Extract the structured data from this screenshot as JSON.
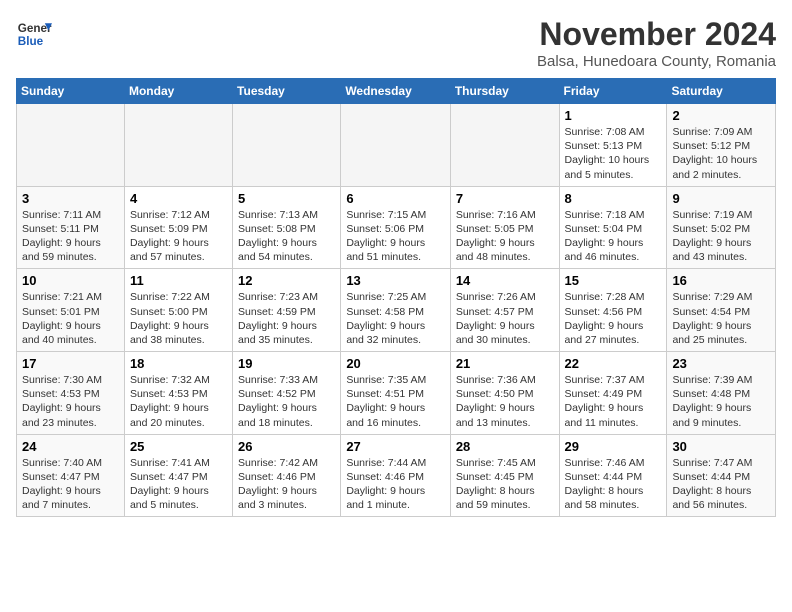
{
  "logo": {
    "line1": "General",
    "line2": "Blue"
  },
  "title": "November 2024",
  "subtitle": "Balsa, Hunedoara County, Romania",
  "headers": [
    "Sunday",
    "Monday",
    "Tuesday",
    "Wednesday",
    "Thursday",
    "Friday",
    "Saturday"
  ],
  "weeks": [
    [
      {
        "day": "",
        "info": ""
      },
      {
        "day": "",
        "info": ""
      },
      {
        "day": "",
        "info": ""
      },
      {
        "day": "",
        "info": ""
      },
      {
        "day": "",
        "info": ""
      },
      {
        "day": "1",
        "info": "Sunrise: 7:08 AM\nSunset: 5:13 PM\nDaylight: 10 hours\nand 5 minutes."
      },
      {
        "day": "2",
        "info": "Sunrise: 7:09 AM\nSunset: 5:12 PM\nDaylight: 10 hours\nand 2 minutes."
      }
    ],
    [
      {
        "day": "3",
        "info": "Sunrise: 7:11 AM\nSunset: 5:11 PM\nDaylight: 9 hours\nand 59 minutes."
      },
      {
        "day": "4",
        "info": "Sunrise: 7:12 AM\nSunset: 5:09 PM\nDaylight: 9 hours\nand 57 minutes."
      },
      {
        "day": "5",
        "info": "Sunrise: 7:13 AM\nSunset: 5:08 PM\nDaylight: 9 hours\nand 54 minutes."
      },
      {
        "day": "6",
        "info": "Sunrise: 7:15 AM\nSunset: 5:06 PM\nDaylight: 9 hours\nand 51 minutes."
      },
      {
        "day": "7",
        "info": "Sunrise: 7:16 AM\nSunset: 5:05 PM\nDaylight: 9 hours\nand 48 minutes."
      },
      {
        "day": "8",
        "info": "Sunrise: 7:18 AM\nSunset: 5:04 PM\nDaylight: 9 hours\nand 46 minutes."
      },
      {
        "day": "9",
        "info": "Sunrise: 7:19 AM\nSunset: 5:02 PM\nDaylight: 9 hours\nand 43 minutes."
      }
    ],
    [
      {
        "day": "10",
        "info": "Sunrise: 7:21 AM\nSunset: 5:01 PM\nDaylight: 9 hours\nand 40 minutes."
      },
      {
        "day": "11",
        "info": "Sunrise: 7:22 AM\nSunset: 5:00 PM\nDaylight: 9 hours\nand 38 minutes."
      },
      {
        "day": "12",
        "info": "Sunrise: 7:23 AM\nSunset: 4:59 PM\nDaylight: 9 hours\nand 35 minutes."
      },
      {
        "day": "13",
        "info": "Sunrise: 7:25 AM\nSunset: 4:58 PM\nDaylight: 9 hours\nand 32 minutes."
      },
      {
        "day": "14",
        "info": "Sunrise: 7:26 AM\nSunset: 4:57 PM\nDaylight: 9 hours\nand 30 minutes."
      },
      {
        "day": "15",
        "info": "Sunrise: 7:28 AM\nSunset: 4:56 PM\nDaylight: 9 hours\nand 27 minutes."
      },
      {
        "day": "16",
        "info": "Sunrise: 7:29 AM\nSunset: 4:54 PM\nDaylight: 9 hours\nand 25 minutes."
      }
    ],
    [
      {
        "day": "17",
        "info": "Sunrise: 7:30 AM\nSunset: 4:53 PM\nDaylight: 9 hours\nand 23 minutes."
      },
      {
        "day": "18",
        "info": "Sunrise: 7:32 AM\nSunset: 4:53 PM\nDaylight: 9 hours\nand 20 minutes."
      },
      {
        "day": "19",
        "info": "Sunrise: 7:33 AM\nSunset: 4:52 PM\nDaylight: 9 hours\nand 18 minutes."
      },
      {
        "day": "20",
        "info": "Sunrise: 7:35 AM\nSunset: 4:51 PM\nDaylight: 9 hours\nand 16 minutes."
      },
      {
        "day": "21",
        "info": "Sunrise: 7:36 AM\nSunset: 4:50 PM\nDaylight: 9 hours\nand 13 minutes."
      },
      {
        "day": "22",
        "info": "Sunrise: 7:37 AM\nSunset: 4:49 PM\nDaylight: 9 hours\nand 11 minutes."
      },
      {
        "day": "23",
        "info": "Sunrise: 7:39 AM\nSunset: 4:48 PM\nDaylight: 9 hours\nand 9 minutes."
      }
    ],
    [
      {
        "day": "24",
        "info": "Sunrise: 7:40 AM\nSunset: 4:47 PM\nDaylight: 9 hours\nand 7 minutes."
      },
      {
        "day": "25",
        "info": "Sunrise: 7:41 AM\nSunset: 4:47 PM\nDaylight: 9 hours\nand 5 minutes."
      },
      {
        "day": "26",
        "info": "Sunrise: 7:42 AM\nSunset: 4:46 PM\nDaylight: 9 hours\nand 3 minutes."
      },
      {
        "day": "27",
        "info": "Sunrise: 7:44 AM\nSunset: 4:46 PM\nDaylight: 9 hours\nand 1 minute."
      },
      {
        "day": "28",
        "info": "Sunrise: 7:45 AM\nSunset: 4:45 PM\nDaylight: 8 hours\nand 59 minutes."
      },
      {
        "day": "29",
        "info": "Sunrise: 7:46 AM\nSunset: 4:44 PM\nDaylight: 8 hours\nand 58 minutes."
      },
      {
        "day": "30",
        "info": "Sunrise: 7:47 AM\nSunset: 4:44 PM\nDaylight: 8 hours\nand 56 minutes."
      }
    ]
  ]
}
